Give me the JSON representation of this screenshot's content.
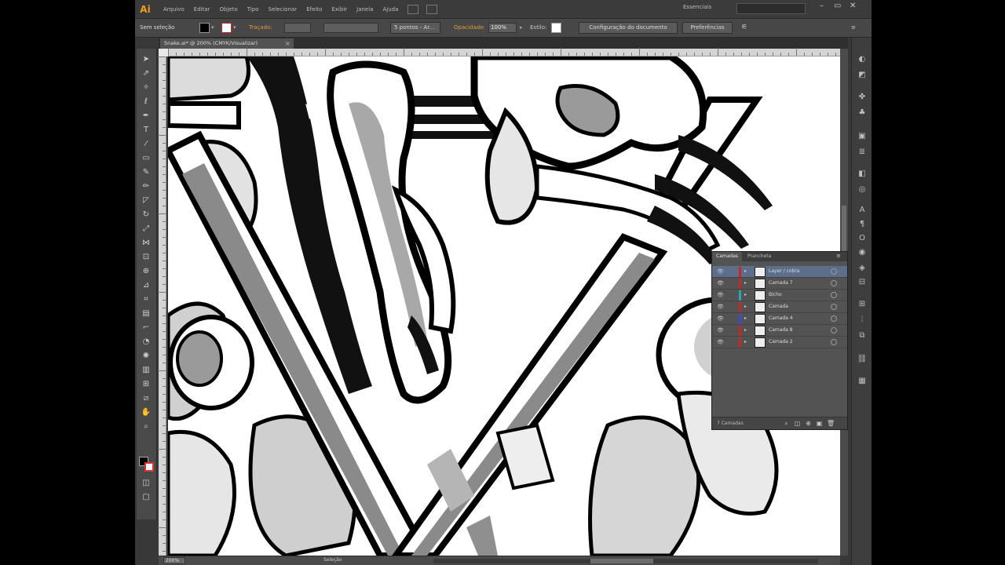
{
  "app": {
    "logo": "Ai",
    "workspace": "Essenciais"
  },
  "menu": [
    "Arquivo",
    "Editar",
    "Objeto",
    "Tipo",
    "Selecionar",
    "Efeito",
    "Exibir",
    "Janela",
    "Ajuda"
  ],
  "search": {
    "placeholder": ""
  },
  "control_bar": {
    "selection_label": "Sem seleção",
    "stroke_label": "Traçado:",
    "brush_select": "5 pontos - Ar...",
    "opacity_label": "Opacidade:",
    "opacity_value": "100%",
    "style_label": "Estilo:",
    "doc_setup_button": "Configuração do documento",
    "preferences_button": "Preferências"
  },
  "document_tab": {
    "title": "Snake.ai* @ 200% (CMYK/Visualizar)",
    "close": "×"
  },
  "status_bar": {
    "zoom": "200%",
    "tool": "Seleção"
  },
  "layers_panel": {
    "tabs": [
      "Camadas",
      "Prancheta"
    ],
    "layers": [
      {
        "name": "Layer / cobra",
        "color": "#c62828",
        "selected": true
      },
      {
        "name": "Camada 7",
        "color": "#c62828",
        "selected": false
      },
      {
        "name": "Bicho",
        "color": "#2aa6b3",
        "selected": false
      },
      {
        "name": "Camada",
        "color": "#c62828",
        "selected": false
      },
      {
        "name": "Camada 4",
        "color": "#3a4ad8",
        "selected": false
      },
      {
        "name": "Camada 8",
        "color": "#c62828",
        "selected": false
      },
      {
        "name": "Camada 2",
        "color": "#c62828",
        "selected": false
      }
    ],
    "count": "7 Camadas"
  },
  "icons": {
    "tools": [
      "selection-icon",
      "direct-selection-icon",
      "magic-wand-icon",
      "lasso-icon",
      "pen-icon",
      "type-icon",
      "line-icon",
      "rectangle-icon",
      "paintbrush-icon",
      "pencil-icon",
      "eraser-icon",
      "rotate-icon",
      "scale-icon",
      "width-icon",
      "free-transform-icon",
      "shape-builder-icon",
      "perspective-icon",
      "mesh-icon",
      "gradient-icon",
      "eyedropper-icon",
      "blend-icon",
      "symbol-sprayer-icon",
      "graph-icon",
      "artboard-icon",
      "slice-icon",
      "hand-icon",
      "zoom-icon"
    ],
    "dock": [
      "color-icon",
      "color-guide-icon",
      "brushes-icon",
      "symbols-icon",
      "graphic-styles-icon",
      "stroke-icon",
      "gradient-panel-icon",
      "transparency-icon",
      "character-icon",
      "paragraph-icon",
      "opentype-icon",
      "appearance-icon",
      "layers-panel-icon",
      "artboards-panel-icon",
      "transform-icon",
      "align-icon",
      "pathfinder-icon",
      "links-icon",
      "navigator-icon"
    ]
  }
}
